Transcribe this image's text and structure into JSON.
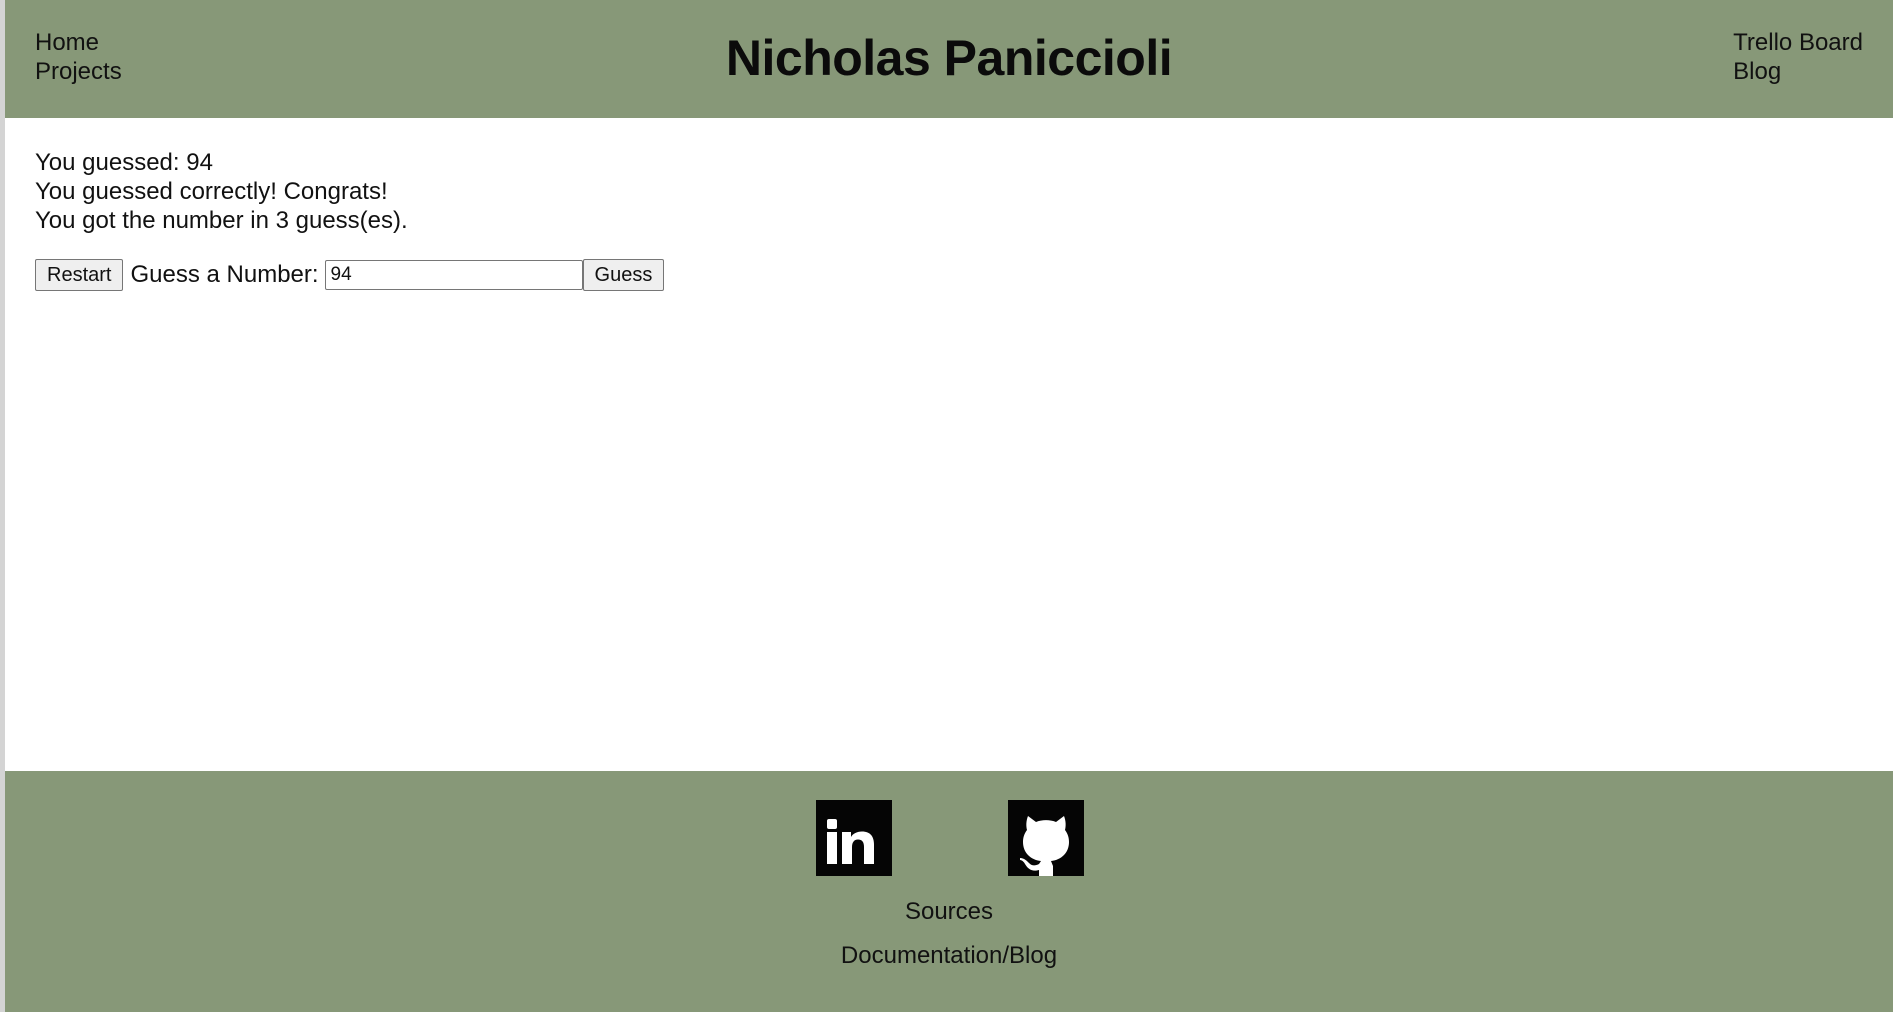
{
  "header": {
    "title": "Nicholas Paniccioli",
    "nav_left": [
      "Home",
      "Projects"
    ],
    "nav_right": [
      "Trello Board",
      "Blog"
    ],
    "background_color": "#879878"
  },
  "game": {
    "last_guess_text": "You guessed: 94",
    "result_text": "You guessed correctly! Congrats!",
    "guess_count_text": "You got the number in 3 guess(es).",
    "restart_label": "Restart",
    "guess_prompt": "Guess a Number:",
    "guess_value": "94",
    "guess_button_label": "Guess"
  },
  "footer": {
    "icons": [
      "linkedin-icon",
      "github-icon"
    ],
    "links": [
      "Sources",
      "Documentation/Blog"
    ],
    "background_color": "#879878"
  }
}
